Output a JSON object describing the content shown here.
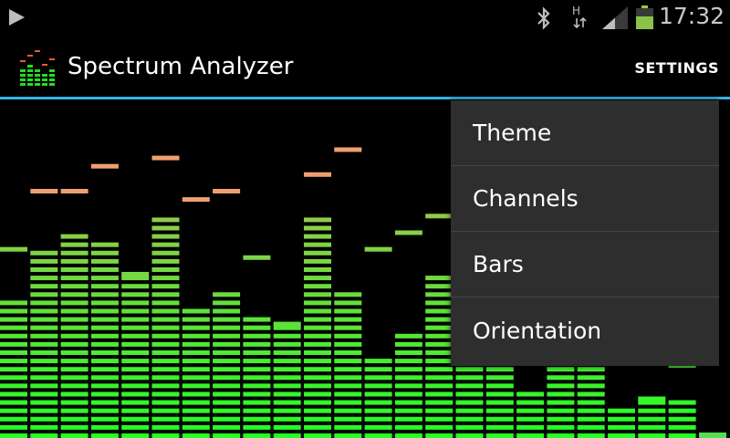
{
  "status_bar": {
    "time": "17:32",
    "network_type": "H",
    "icons": [
      "play-icon",
      "bluetooth-icon",
      "data-arrows-icon",
      "signal-icon",
      "battery-icon"
    ],
    "battery_level": 0.6,
    "signal_level": 0.5
  },
  "action_bar": {
    "title": "Spectrum Analyzer",
    "settings_label": "SETTINGS",
    "divider_color": "#33b5e5"
  },
  "menu": {
    "items": [
      "Theme",
      "Channels",
      "Bars",
      "Orientation"
    ]
  },
  "spectrum": {
    "bar_count": 24,
    "max_segments": 40,
    "levels": [
      17,
      23,
      25,
      24,
      20,
      27,
      16,
      18,
      15,
      14,
      27,
      18,
      10,
      13,
      20,
      13,
      9,
      6,
      11,
      13,
      4,
      5,
      5,
      0
    ],
    "peaks": [
      23,
      30,
      30,
      33,
      20,
      34,
      29,
      30,
      22,
      14,
      32,
      35,
      23,
      25,
      27,
      30,
      20,
      21,
      26,
      20,
      20,
      5,
      9,
      0
    ],
    "bottom_color": "#22ff22",
    "top_color": "#c8b060",
    "peak_color": "#f0a070"
  }
}
